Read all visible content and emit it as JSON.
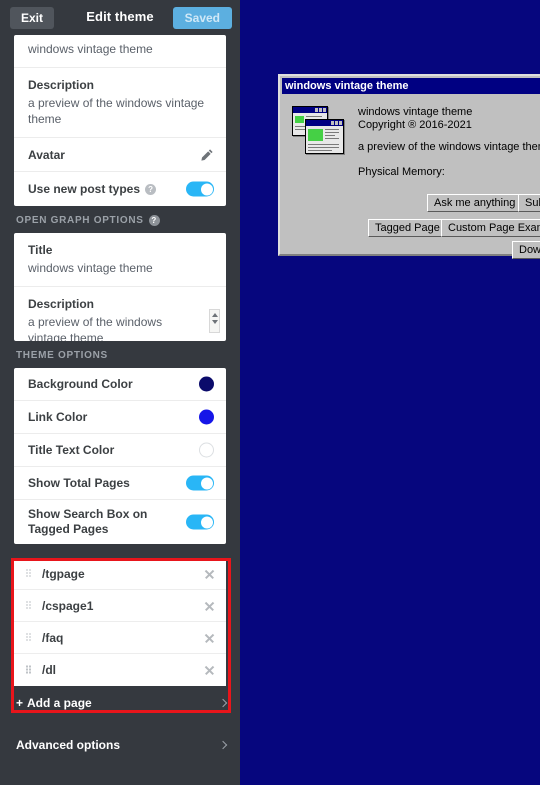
{
  "editor": {
    "header": {
      "exit_label": "Exit",
      "title": "Edit theme",
      "saved_label": "Saved"
    },
    "top_fragment": {
      "title_value": "windows vintage theme"
    },
    "blog_rows": [
      {
        "label": "Description",
        "value": "a preview of the windows vintage theme"
      },
      {
        "label": "Avatar",
        "icon": "pencil-icon"
      },
      {
        "label": "Use new post types",
        "help": "?",
        "toggle": true
      }
    ],
    "open_graph": {
      "section_label": "OPEN GRAPH OPTIONS",
      "help": "?",
      "title_label": "Title",
      "title_value": "windows vintage theme",
      "description_label": "Description",
      "description_value": "a preview of the windows vintage theme"
    },
    "theme_options": {
      "section_label": "THEME OPTIONS",
      "rows": [
        {
          "label": "Background Color",
          "type": "swatch",
          "color": "#0B0B6B"
        },
        {
          "label": "Link Color",
          "type": "swatch",
          "color": "#1616E8"
        },
        {
          "label": "Title Text Color",
          "type": "swatch",
          "color": "#FFFFFF"
        },
        {
          "label": "Show Total Pages",
          "type": "toggle"
        },
        {
          "label": "Show Search Box on Tagged Pages",
          "type": "toggle"
        }
      ]
    },
    "pages": {
      "items": [
        {
          "path": "/tgpage"
        },
        {
          "path": "/cspage1"
        },
        {
          "path": "/faq"
        },
        {
          "path": "/dl"
        }
      ],
      "add_label": "Add a page",
      "add_plus": "+"
    },
    "advanced_label": "Advanced options",
    "highlight_color": "#E8151B"
  },
  "dialog": {
    "titlebar": "windows vintage theme",
    "app_name": "windows vintage theme",
    "copyright": "Copyright ® 2016-2021",
    "description": "a preview of the windows vintage theme",
    "memory_label": "Physical Memory:",
    "buttons": [
      {
        "label": "Ask me anything"
      },
      {
        "label": "Submit a"
      },
      {
        "label": "Tagged Page"
      },
      {
        "label": "Custom Page Example"
      },
      {
        "label": "Down"
      }
    ]
  }
}
